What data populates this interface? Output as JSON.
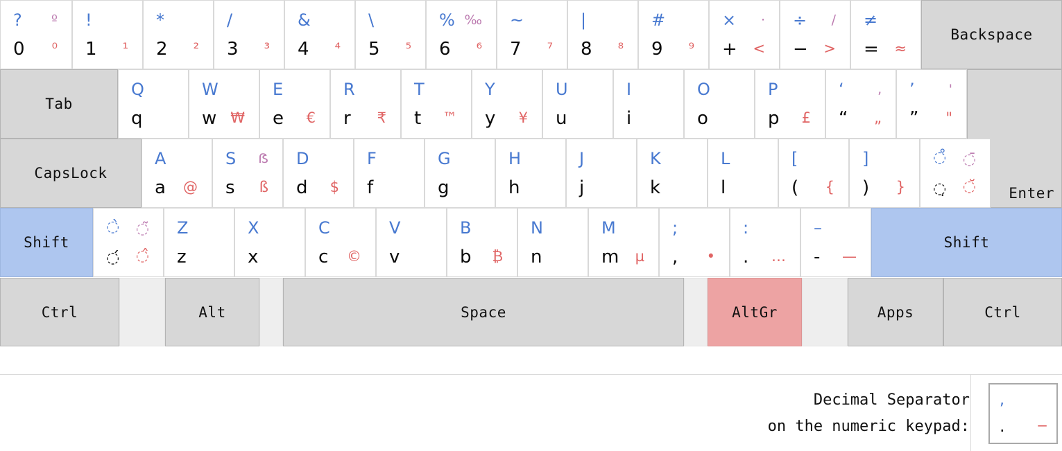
{
  "meta": {
    "view": "keyboard-layout-preview",
    "colors": {
      "base": "#0b0b0b",
      "shift": "#4879d0",
      "altgr": "#e06464",
      "altgr_shift": "#bc7bb0",
      "modifier_bg": "#d7d7d7",
      "shift_key_bg": "#aec6ef",
      "altgr_key_bg": "#eda3a3",
      "spacer_bg": "#eeeeee",
      "page_bg": "#ffffff"
    }
  },
  "rows": {
    "number_row": [
      {
        "name": "key-0",
        "base": "0",
        "shift": "?",
        "altgr": "⁰",
        "altgr_shift": "º"
      },
      {
        "name": "key-1",
        "base": "1",
        "shift": "!",
        "altgr": "¹",
        "altgr_shift": ""
      },
      {
        "name": "key-2",
        "base": "2",
        "shift": "*",
        "altgr": "²",
        "altgr_shift": ""
      },
      {
        "name": "key-3",
        "base": "3",
        "shift": "/",
        "altgr": "³",
        "altgr_shift": ""
      },
      {
        "name": "key-4",
        "base": "4",
        "shift": "&",
        "altgr": "⁴",
        "altgr_shift": ""
      },
      {
        "name": "key-5",
        "base": "5",
        "shift": "\\",
        "altgr": "⁵",
        "altgr_shift": ""
      },
      {
        "name": "key-6",
        "base": "6",
        "shift": "%",
        "altgr": "⁶",
        "altgr_shift": "‰"
      },
      {
        "name": "key-7",
        "base": "7",
        "shift": "~",
        "altgr": "⁷",
        "altgr_shift": ""
      },
      {
        "name": "key-8",
        "base": "8",
        "shift": "|",
        "altgr": "⁸",
        "altgr_shift": ""
      },
      {
        "name": "key-9",
        "base": "9",
        "shift": "#",
        "altgr": "⁹",
        "altgr_shift": ""
      },
      {
        "name": "key-plus",
        "base": "+",
        "shift": "×",
        "altgr": "<",
        "altgr_shift": "⋅"
      },
      {
        "name": "key-minus",
        "base": "−",
        "shift": "÷",
        "altgr": ">",
        "altgr_shift": "∕"
      },
      {
        "name": "key-equal",
        "base": "=",
        "shift": "≠",
        "altgr": "≈",
        "altgr_shift": ""
      }
    ],
    "top_row": [
      {
        "name": "key-q",
        "base": "q",
        "shift": "Q",
        "altgr": "",
        "altgr_shift": ""
      },
      {
        "name": "key-w",
        "base": "w",
        "shift": "W",
        "altgr": "₩",
        "altgr_shift": ""
      },
      {
        "name": "key-e",
        "base": "e",
        "shift": "E",
        "altgr": "€",
        "altgr_shift": ""
      },
      {
        "name": "key-r",
        "base": "r",
        "shift": "R",
        "altgr": "₹",
        "altgr_shift": ""
      },
      {
        "name": "key-t",
        "base": "t",
        "shift": "T",
        "altgr": "™",
        "altgr_shift": ""
      },
      {
        "name": "key-y",
        "base": "y",
        "shift": "Y",
        "altgr": "¥",
        "altgr_shift": ""
      },
      {
        "name": "key-u",
        "base": "u",
        "shift": "U",
        "altgr": "",
        "altgr_shift": ""
      },
      {
        "name": "key-i",
        "base": "i",
        "shift": "I",
        "altgr": "",
        "altgr_shift": ""
      },
      {
        "name": "key-o",
        "base": "o",
        "shift": "O",
        "altgr": "",
        "altgr_shift": ""
      },
      {
        "name": "key-p",
        "base": "p",
        "shift": "P",
        "altgr": "£",
        "altgr_shift": ""
      },
      {
        "name": "key-bracketleft",
        "base": "“",
        "shift": "‘",
        "altgr": "„",
        "altgr_shift": "‚"
      },
      {
        "name": "key-bracketright",
        "base": "”",
        "shift": "’",
        "altgr": "\"",
        "altgr_shift": "'"
      }
    ],
    "home_row": [
      {
        "name": "key-a",
        "base": "a",
        "shift": "A",
        "altgr": "@",
        "altgr_shift": ""
      },
      {
        "name": "key-s",
        "base": "s",
        "shift": "S",
        "altgr": "ß",
        "altgr_shift": "ẞ"
      },
      {
        "name": "key-d",
        "base": "d",
        "shift": "D",
        "altgr": "$",
        "altgr_shift": ""
      },
      {
        "name": "key-f",
        "base": "f",
        "shift": "F",
        "altgr": "",
        "altgr_shift": ""
      },
      {
        "name": "key-g",
        "base": "g",
        "shift": "G",
        "altgr": "",
        "altgr_shift": ""
      },
      {
        "name": "key-h",
        "base": "h",
        "shift": "H",
        "altgr": "",
        "altgr_shift": ""
      },
      {
        "name": "key-j",
        "base": "j",
        "shift": "J",
        "altgr": "",
        "altgr_shift": ""
      },
      {
        "name": "key-k",
        "base": "k",
        "shift": "K",
        "altgr": "",
        "altgr_shift": ""
      },
      {
        "name": "key-l",
        "base": "l",
        "shift": "L",
        "altgr": "",
        "altgr_shift": ""
      },
      {
        "name": "key-parenleft",
        "base": "(",
        "shift": "[",
        "altgr": "{",
        "altgr_shift": ""
      },
      {
        "name": "key-parenright",
        "base": ")",
        "shift": "]",
        "altgr": "}",
        "altgr_shift": ""
      },
      {
        "name": "key-dead-ring",
        "base": "◌̣",
        "shift": "◌̊",
        "altgr": "◌̆",
        "altgr_shift": "◌̄",
        "dead": true
      }
    ],
    "bottom_row": [
      {
        "name": "key-dead-grave",
        "base": "◌́",
        "shift": "◌̀",
        "altgr": "◌̂",
        "altgr_shift": "◌̃",
        "dead": true
      },
      {
        "name": "key-z",
        "base": "z",
        "shift": "Z",
        "altgr": "",
        "altgr_shift": ""
      },
      {
        "name": "key-x",
        "base": "x",
        "shift": "X",
        "altgr": "",
        "altgr_shift": ""
      },
      {
        "name": "key-c",
        "base": "c",
        "shift": "C",
        "altgr": "©",
        "altgr_shift": ""
      },
      {
        "name": "key-v",
        "base": "v",
        "shift": "V",
        "altgr": "",
        "altgr_shift": ""
      },
      {
        "name": "key-b",
        "base": "b",
        "shift": "B",
        "altgr": "₿",
        "altgr_shift": ""
      },
      {
        "name": "key-n",
        "base": "n",
        "shift": "N",
        "altgr": "",
        "altgr_shift": ""
      },
      {
        "name": "key-m",
        "base": "m",
        "shift": "M",
        "altgr": "µ",
        "altgr_shift": ""
      },
      {
        "name": "key-comma",
        "base": ",",
        "shift": ";",
        "altgr": "•",
        "altgr_shift": ""
      },
      {
        "name": "key-period",
        "base": ".",
        "shift": ":",
        "altgr": "…",
        "altgr_shift": ""
      },
      {
        "name": "key-dash",
        "base": "-",
        "shift": "–",
        "altgr": "—",
        "altgr_shift": ""
      }
    ]
  },
  "modifiers": {
    "backspace": "Backspace",
    "tab": "Tab",
    "capslock": "CapsLock",
    "enter": "Enter",
    "shift_left": "Shift",
    "shift_right": "Shift",
    "ctrl_left": "Ctrl",
    "alt_left": "Alt",
    "space": "Space",
    "altgr": "AltGr",
    "apps": "Apps",
    "ctrl_right": "Ctrl"
  },
  "footer": {
    "label": "Decimal Separator\non the numeric keypad:",
    "decimal_key": {
      "name": "decimal-separator-key",
      "base": ".",
      "shift": ",",
      "altgr": "−",
      "altgr_shift": ""
    }
  }
}
